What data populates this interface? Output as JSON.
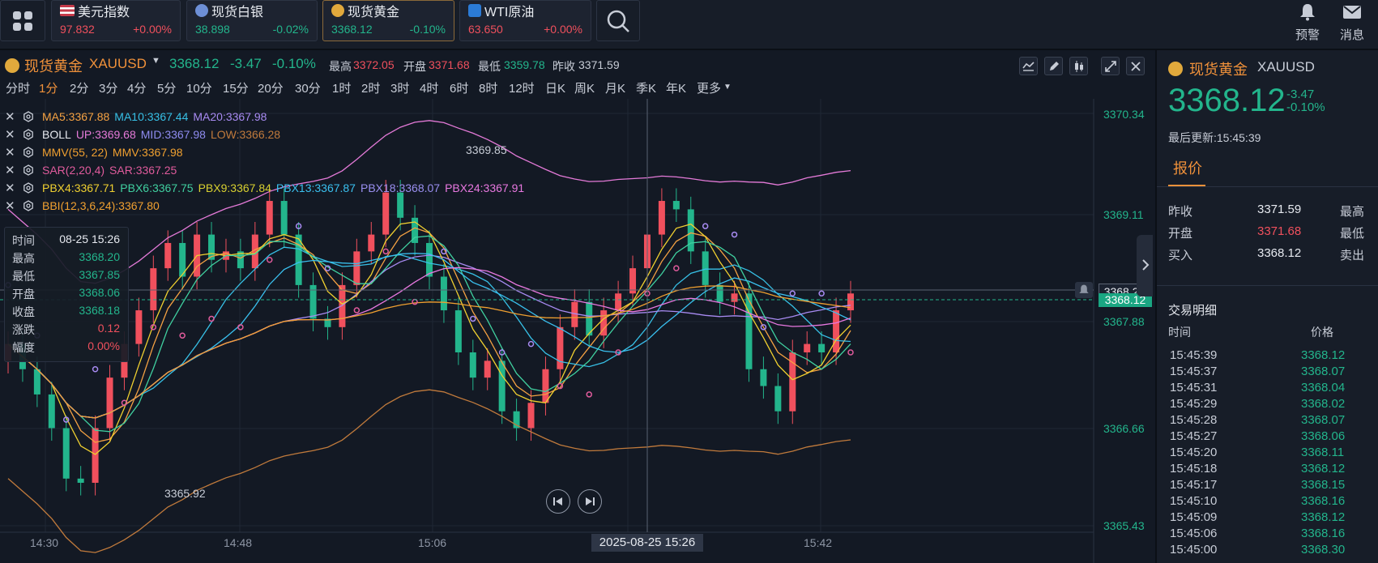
{
  "topbar": {
    "tickers": [
      {
        "name": "美元指数",
        "price": "97.832",
        "change": "+0.00%",
        "price_color": "#f0505d",
        "change_color": "#f0505d",
        "icon": "us-flag-icon"
      },
      {
        "name": "现货白银",
        "price": "38.898",
        "change": "-0.02%",
        "price_color": "#23b58c",
        "change_color": "#23b58c",
        "icon": "silver-icon"
      },
      {
        "name": "现货黄金",
        "price": "3368.12",
        "change": "-0.10%",
        "price_color": "#23b58c",
        "change_color": "#23b58c",
        "icon": "gold-icon"
      },
      {
        "name": "WTI原油",
        "price": "63.650",
        "change": "+0.00%",
        "price_color": "#f0505d",
        "change_color": "#f0505d",
        "icon": "oil-icon"
      }
    ],
    "alert_label": "预警",
    "message_label": "消息"
  },
  "header": {
    "name": "现货黄金",
    "symbol": "XAUUSD",
    "price": "3368.12",
    "change": "-3.47",
    "change_pct": "-0.10%",
    "high_label": "最高",
    "high": "3372.05",
    "open_label": "开盘",
    "open": "3371.68",
    "low_label": "最低",
    "low": "3359.78",
    "prev_label": "昨收",
    "prev": "3371.59"
  },
  "periods": [
    "分时",
    "1分",
    "2分",
    "3分",
    "4分",
    "5分",
    "10分",
    "15分",
    "20分",
    "30分",
    "1时",
    "2时",
    "3时",
    "4时",
    "6时",
    "8时",
    "12时",
    "日K",
    "周K",
    "月K",
    "季K",
    "年K",
    "更多"
  ],
  "active_period": "1分",
  "indicators": [
    {
      "parts": [
        {
          "t": "MA5:3367.88",
          "c": "#f5a243"
        },
        {
          "t": "MA10:3367.44",
          "c": "#37c0e6"
        },
        {
          "t": "MA20:3367.98",
          "c": "#a88bf2"
        }
      ]
    },
    {
      "parts": [
        {
          "t": "BOLL",
          "c": "#e6e9ef"
        },
        {
          "t": "UP:3369.68",
          "c": "#e47ad8"
        },
        {
          "t": "MID:3367.98",
          "c": "#8f8cf0"
        },
        {
          "t": "LOW:3366.28",
          "c": "#c07a3c"
        }
      ]
    },
    {
      "parts": [
        {
          "t": "MMV(55, 22)",
          "c": "#f0a030"
        },
        {
          "t": "MMV:3367.98",
          "c": "#f0a030"
        }
      ]
    },
    {
      "parts": [
        {
          "t": "SAR(2,20,4)",
          "c": "#e05b9c"
        },
        {
          "t": "SAR:3367.25",
          "c": "#e05b9c"
        }
      ]
    },
    {
      "parts": [
        {
          "t": "PBX4:3367.71",
          "c": "#f0d030"
        },
        {
          "t": "PBX6:3367.75",
          "c": "#40d0a0"
        },
        {
          "t": "PBX9:3367.84",
          "c": "#d8d030"
        },
        {
          "t": "PBX13:3367.87",
          "c": "#3ac0ef"
        },
        {
          "t": "PBX18:3368.07",
          "c": "#9a8ff0"
        },
        {
          "t": "PBX24:3367.91",
          "c": "#e878e0"
        }
      ]
    },
    {
      "parts": [
        {
          "t": "BBI(12,3,6,24):3367.80",
          "c": "#f0a030"
        }
      ]
    }
  ],
  "tooltip": {
    "rows": [
      {
        "k": "时间",
        "v": "08-25 15:26",
        "c": "#e6e9ef"
      },
      {
        "k": "最高",
        "v": "3368.20",
        "c": "#23b58c"
      },
      {
        "k": "最低",
        "v": "3367.85",
        "c": "#23b58c"
      },
      {
        "k": "开盘",
        "v": "3368.06",
        "c": "#23b58c"
      },
      {
        "k": "收盘",
        "v": "3368.18",
        "c": "#23b58c"
      },
      {
        "k": "涨跌",
        "v": "0.12",
        "c": "#f0505d"
      },
      {
        "k": "幅度",
        "v": "0.00%",
        "c": "#f0505d"
      }
    ]
  },
  "chart_data": {
    "type": "candlestick",
    "y_ticks": [
      "3370.34",
      "3369.11",
      "3367.88",
      "3366.66",
      "3365.43"
    ],
    "x_ticks": [
      "14:30",
      "14:48",
      "15:06",
      "15:42"
    ],
    "ylim": [
      3365.43,
      3370.34
    ],
    "crosshair_time": "2025-08-25 15:26",
    "crosshair_price": "3368.22",
    "last_price": "3368.12",
    "annot_high": "3369.85",
    "annot_low": "3365.92",
    "candles": [
      {
        "o": 3367.4,
        "c": 3367.6
      },
      {
        "o": 3367.6,
        "c": 3367.3
      },
      {
        "o": 3367.3,
        "c": 3367.0
      },
      {
        "o": 3367.0,
        "c": 3366.6
      },
      {
        "o": 3366.6,
        "c": 3366.0
      },
      {
        "o": 3366.0,
        "c": 3365.95
      },
      {
        "o": 3365.95,
        "c": 3366.6
      },
      {
        "o": 3366.6,
        "c": 3367.2
      },
      {
        "o": 3367.2,
        "c": 3367.6
      },
      {
        "o": 3367.6,
        "c": 3368.0
      },
      {
        "o": 3368.0,
        "c": 3368.5
      },
      {
        "o": 3368.5,
        "c": 3368.8
      },
      {
        "o": 3368.8,
        "c": 3368.4
      },
      {
        "o": 3368.4,
        "c": 3368.9
      },
      {
        "o": 3368.9,
        "c": 3368.6
      },
      {
        "o": 3368.6,
        "c": 3368.7
      },
      {
        "o": 3368.7,
        "c": 3368.5
      },
      {
        "o": 3368.5,
        "c": 3368.9
      },
      {
        "o": 3368.9,
        "c": 3369.3
      },
      {
        "o": 3369.3,
        "c": 3368.9
      },
      {
        "o": 3368.9,
        "c": 3368.3
      },
      {
        "o": 3368.3,
        "c": 3367.9
      },
      {
        "o": 3367.9,
        "c": 3367.8
      },
      {
        "o": 3367.8,
        "c": 3368.3
      },
      {
        "o": 3368.3,
        "c": 3368.7
      },
      {
        "o": 3368.7,
        "c": 3368.9
      },
      {
        "o": 3368.9,
        "c": 3369.4
      },
      {
        "o": 3369.4,
        "c": 3369.1
      },
      {
        "o": 3369.1,
        "c": 3368.8
      },
      {
        "o": 3368.8,
        "c": 3368.4
      },
      {
        "o": 3368.4,
        "c": 3368.0
      },
      {
        "o": 3368.0,
        "c": 3367.5
      },
      {
        "o": 3367.5,
        "c": 3367.2
      },
      {
        "o": 3367.2,
        "c": 3367.4
      },
      {
        "o": 3367.4,
        "c": 3366.8
      },
      {
        "o": 3366.8,
        "c": 3366.6
      },
      {
        "o": 3366.6,
        "c": 3366.9
      },
      {
        "o": 3366.9,
        "c": 3367.3
      },
      {
        "o": 3367.3,
        "c": 3367.8
      },
      {
        "o": 3367.8,
        "c": 3368.1
      },
      {
        "o": 3368.1,
        "c": 3367.7
      },
      {
        "o": 3367.7,
        "c": 3368.0
      },
      {
        "o": 3368.0,
        "c": 3368.2
      },
      {
        "o": 3368.2,
        "c": 3368.5
      },
      {
        "o": 3368.5,
        "c": 3368.9
      },
      {
        "o": 3368.9,
        "c": 3369.3
      },
      {
        "o": 3369.3,
        "c": 3369.2
      },
      {
        "o": 3369.2,
        "c": 3368.7
      },
      {
        "o": 3368.7,
        "c": 3368.3
      },
      {
        "o": 3368.3,
        "c": 3368.1
      },
      {
        "o": 3368.1,
        "c": 3368.2
      },
      {
        "o": 3368.2,
        "c": 3367.3
      },
      {
        "o": 3367.3,
        "c": 3367.1
      },
      {
        "o": 3367.1,
        "c": 3366.8
      },
      {
        "o": 3366.8,
        "c": 3367.5
      },
      {
        "o": 3367.5,
        "c": 3367.6
      },
      {
        "o": 3367.6,
        "c": 3367.5
      },
      {
        "o": 3367.5,
        "c": 3368.0
      },
      {
        "o": 3368.0,
        "c": 3368.2
      }
    ]
  },
  "right_panel": {
    "name": "现货黄金",
    "symbol": "XAUUSD",
    "price": "3368.12",
    "change": "-3.47",
    "change_pct": "-0.10%",
    "updated": "最后更新:15:45:39",
    "tab": "报价",
    "quote_rows": [
      {
        "k": "昨收",
        "v": "3371.59",
        "c": "#e6e9ef",
        "k2": "最高"
      },
      {
        "k": "开盘",
        "v": "3371.68",
        "c": "#f0505d",
        "k2": "最低"
      },
      {
        "k": "买入",
        "v": "3368.12",
        "c": "#e6e9ef",
        "k2": "卖出"
      }
    ],
    "trades_title": "交易明细",
    "col_time": "时间",
    "col_price": "价格",
    "trades": [
      [
        "15:45:39",
        "3368.12"
      ],
      [
        "15:45:37",
        "3368.07"
      ],
      [
        "15:45:31",
        "3368.04"
      ],
      [
        "15:45:29",
        "3368.02"
      ],
      [
        "15:45:28",
        "3368.07"
      ],
      [
        "15:45:27",
        "3368.06"
      ],
      [
        "15:45:20",
        "3368.11"
      ],
      [
        "15:45:18",
        "3368.12"
      ],
      [
        "15:45:17",
        "3368.15"
      ],
      [
        "15:45:10",
        "3368.16"
      ],
      [
        "15:45:09",
        "3368.12"
      ],
      [
        "15:45:06",
        "3368.16"
      ],
      [
        "15:45:00",
        "3368.30"
      ]
    ]
  },
  "colors": {
    "up": "#f0505d",
    "down": "#23b58c",
    "accent": "#f0913a"
  }
}
